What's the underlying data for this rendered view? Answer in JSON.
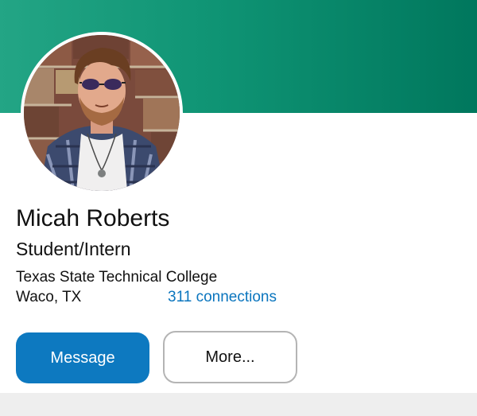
{
  "profile": {
    "name": "Micah Roberts",
    "headline": "Student/Intern",
    "organization": "Texas State Technical College",
    "location": "Waco, TX",
    "connections": "311 connections"
  },
  "actions": {
    "message_label": "Message",
    "more_label": "More..."
  },
  "colors": {
    "cover_gradient_start": "#23a585",
    "cover_gradient_end": "#00775d",
    "primary_button": "#0d79c0",
    "link": "#0a75be"
  }
}
